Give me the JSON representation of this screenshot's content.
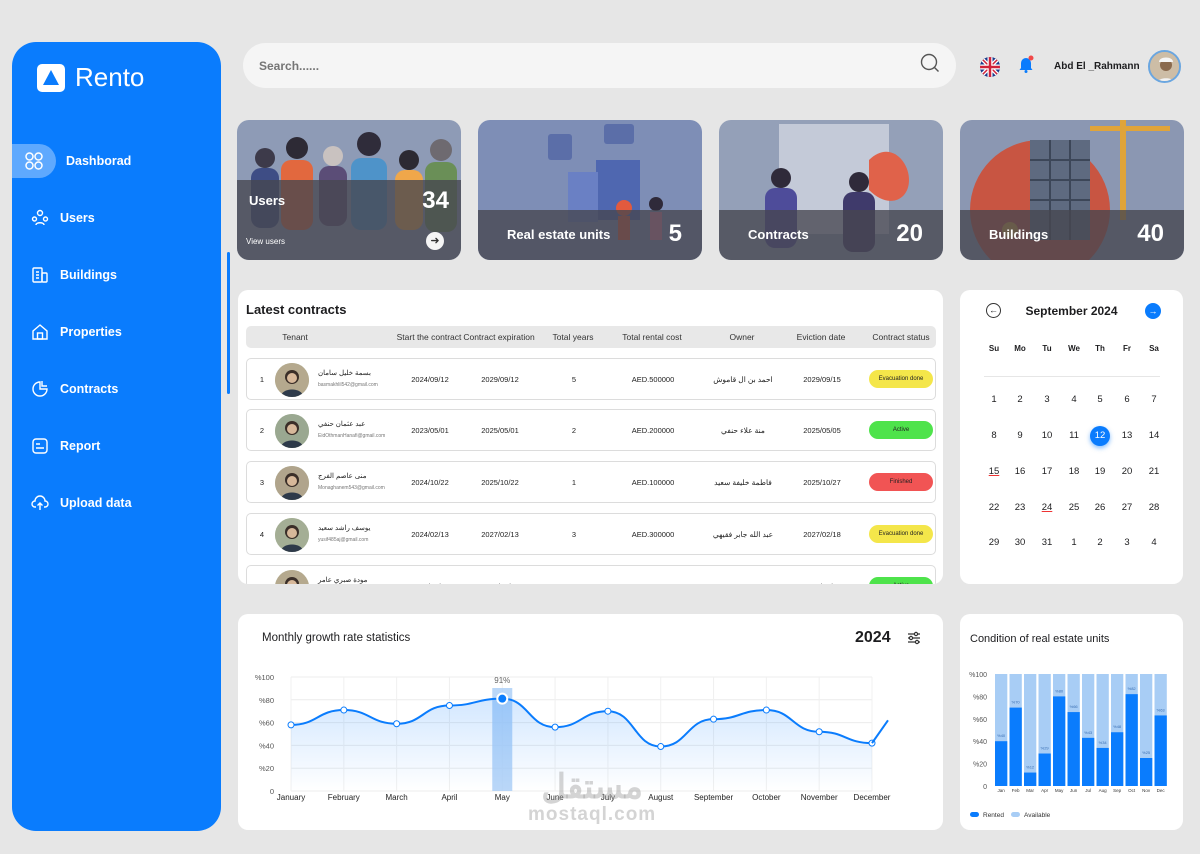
{
  "app": {
    "name": "Rento"
  },
  "sidebar": {
    "items": [
      {
        "label": "Dashborad",
        "icon": "grid-icon"
      },
      {
        "label": "Users",
        "icon": "users-icon"
      },
      {
        "label": "Buildings",
        "icon": "building-icon"
      },
      {
        "label": "Properties",
        "icon": "home-icon"
      },
      {
        "label": "Contracts",
        "icon": "contract-icon"
      },
      {
        "label": "Report",
        "icon": "report-icon"
      },
      {
        "label": "Upload data",
        "icon": "cloud-upload-icon"
      }
    ]
  },
  "header": {
    "search_placeholder": "Search......",
    "user_name": "Abd El _Rahmann"
  },
  "stats": [
    {
      "label": "Users",
      "value": "34",
      "link": "View users"
    },
    {
      "label": "Real estate units",
      "value": "5"
    },
    {
      "label": "Contracts",
      "value": "20"
    },
    {
      "label": "Buildings",
      "value": "40"
    }
  ],
  "contracts": {
    "title": "Latest contracts",
    "columns": [
      "Tenant",
      "Start the contract",
      "Contract expiration",
      "Total years",
      "Total rental cost",
      "Owner",
      "Eviction date",
      "Contract status"
    ],
    "rows": [
      {
        "n": "1",
        "name": "بسمة خليل سامان",
        "email": "basmakhlil542@gmail.com",
        "start": "2024/09/12",
        "end": "2029/09/12",
        "years": "5",
        "cost": "AED.500000",
        "owner": "احمد بن ال قاموش",
        "evict": "2029/09/15",
        "status": "Evacuation done",
        "color": "#f4e64a"
      },
      {
        "n": "2",
        "name": "عبد عثمان حنفي",
        "email": "EidOthmanHanafi@gmail.com",
        "start": "2023/05/01",
        "end": "2025/05/01",
        "years": "2",
        "cost": "AED.200000",
        "owner": "منة علاء حنفي",
        "evict": "2025/05/05",
        "status": "Active",
        "color": "#4ee34b"
      },
      {
        "n": "3",
        "name": "منى عاصم الفرج",
        "email": "Monaghanem543@gmail.com",
        "start": "2024/10/22",
        "end": "2025/10/22",
        "years": "1",
        "cost": "AED.100000",
        "owner": "فاطمة خليفة سعيد",
        "evict": "2025/10/27",
        "status": "Finished",
        "color": "#f15454"
      },
      {
        "n": "4",
        "name": "يوسف راشد سعيد",
        "email": "yusif485aj@gmail.com",
        "start": "2024/02/13",
        "end": "2027/02/13",
        "years": "3",
        "cost": "AED.300000",
        "owner": "عبد الله جابر فقيهي",
        "evict": "2027/02/18",
        "status": "Evacuation done",
        "color": "#f4e64a"
      },
      {
        "n": "5",
        "name": "مودة صبري عامر",
        "email": "",
        "start": "2024/08/12",
        "end": "2029/08/12",
        "years": "5",
        "cost": "AED.500000",
        "owner": "",
        "evict": "2029/08/15",
        "status": "Active",
        "color": "#4ee34b"
      }
    ]
  },
  "calendar": {
    "title": "September 2024",
    "weekdays": [
      "Su",
      "Mo",
      "Tu",
      "We",
      "Th",
      "Fr",
      "Sa"
    ],
    "weeks": [
      [
        "1",
        "2",
        "3",
        "4",
        "5",
        "6",
        "7"
      ],
      [
        "8",
        "9",
        "10",
        "11",
        "12",
        "13",
        "14"
      ],
      [
        "15",
        "16",
        "17",
        "18",
        "19",
        "20",
        "21"
      ],
      [
        "22",
        "23",
        "24",
        "25",
        "26",
        "27",
        "28"
      ],
      [
        "29",
        "30",
        "31",
        "1",
        "2",
        "3",
        "4"
      ]
    ],
    "selected": "12",
    "accent": "#0a7cfd"
  },
  "growth": {
    "title": "Monthly growth rate statistics",
    "year": "2024",
    "chart_data": {
      "type": "line",
      "categories": [
        "January",
        "February",
        "March",
        "April",
        "May",
        "June",
        "July",
        "August",
        "September",
        "October",
        "November",
        "December"
      ],
      "values": [
        58,
        71,
        59,
        75,
        81,
        56,
        70,
        39,
        63,
        71,
        52,
        42
      ],
      "highlight": {
        "index": 4,
        "label": "91%"
      },
      "ylim": [
        0,
        100
      ],
      "yticks": [
        "0",
        "%20",
        "%40",
        "%60",
        "%80",
        "%100"
      ]
    }
  },
  "condition": {
    "title": "Condition of real estate units",
    "chart_data": {
      "type": "bar",
      "categories": [
        "Jan",
        "Feb",
        "Mar",
        "Apr",
        "May",
        "Jun",
        "Jul",
        "Aug",
        "Sep",
        "Oct",
        "Nov",
        "Dec"
      ],
      "series": [
        {
          "name": "Rented",
          "values": [
            40,
            70,
            12,
            29,
            80,
            66,
            43,
            34,
            48,
            82,
            25,
            63
          ],
          "color": "#0a7cfd"
        },
        {
          "name": "Available",
          "values": [
            100,
            100,
            100,
            100,
            100,
            100,
            100,
            100,
            100,
            100,
            100,
            100
          ],
          "color": "#a8cdf5"
        }
      ],
      "ylim": [
        0,
        100
      ],
      "yticks": [
        "0",
        "%20",
        "%40",
        "%60",
        "%80",
        "%100"
      ]
    }
  },
  "watermark": {
    "arabic": "مستقل",
    "latin": "mostaql.com"
  }
}
